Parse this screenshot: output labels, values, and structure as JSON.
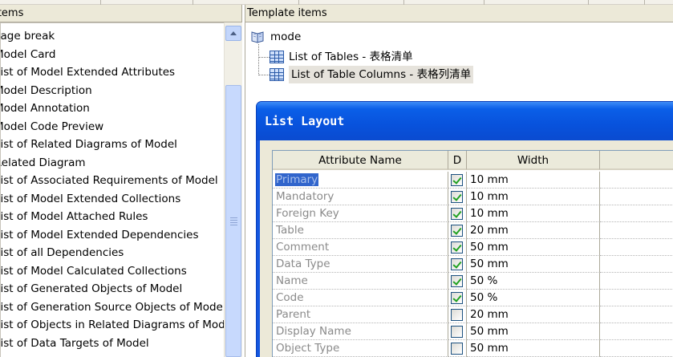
{
  "left_panel": {
    "header": "Items",
    "items": [
      "Page break",
      "Model Card",
      "List of Model Extended Attributes",
      "Model Description",
      "Model Annotation",
      "Model Code Preview",
      "List of Related Diagrams of Model",
      "Related Diagram",
      "List of Associated Requirements of Model",
      "List of Model Extended Collections",
      "List of Model Attached Rules",
      "List of Model Extended Dependencies",
      "List of all Dependencies",
      "List of Model Calculated Collections",
      "List of Generated Objects of Model",
      "List of Generation Source Objects of Model",
      "List of Objects in Related Diagrams of Model",
      "List of Data Targets of Model"
    ]
  },
  "right_panel": {
    "header": "Template items",
    "tree": {
      "root": "mode",
      "children": [
        "List of Tables - 表格清单",
        "List of Table Columns - 表格列清单"
      ],
      "selected_index": 1
    }
  },
  "dialog": {
    "title": "List Layout",
    "columns": {
      "name": "Attribute Name",
      "d": "D",
      "width": "Width"
    },
    "rows": [
      {
        "name": "Primary",
        "checked": true,
        "width": "10 mm"
      },
      {
        "name": "Mandatory",
        "checked": true,
        "width": "10 mm"
      },
      {
        "name": "Foreign Key",
        "checked": true,
        "width": "10 mm"
      },
      {
        "name": "Table",
        "checked": true,
        "width": "20 mm"
      },
      {
        "name": "Comment",
        "checked": true,
        "width": "50 mm"
      },
      {
        "name": "Data Type",
        "checked": true,
        "width": "50 mm"
      },
      {
        "name": "Name",
        "checked": true,
        "width": "50 %"
      },
      {
        "name": "Code",
        "checked": true,
        "width": "50 %"
      },
      {
        "name": "Parent",
        "checked": false,
        "width": "20 mm"
      },
      {
        "name": "Display Name",
        "checked": false,
        "width": "50 mm"
      },
      {
        "name": "Object Type",
        "checked": false,
        "width": "50 mm"
      }
    ],
    "selected_row": 0
  },
  "colors": {
    "titlebar": "#0852dc",
    "selection": "#3165cc",
    "checkmark": "#21a121",
    "panel_header": "#ece9d8"
  }
}
